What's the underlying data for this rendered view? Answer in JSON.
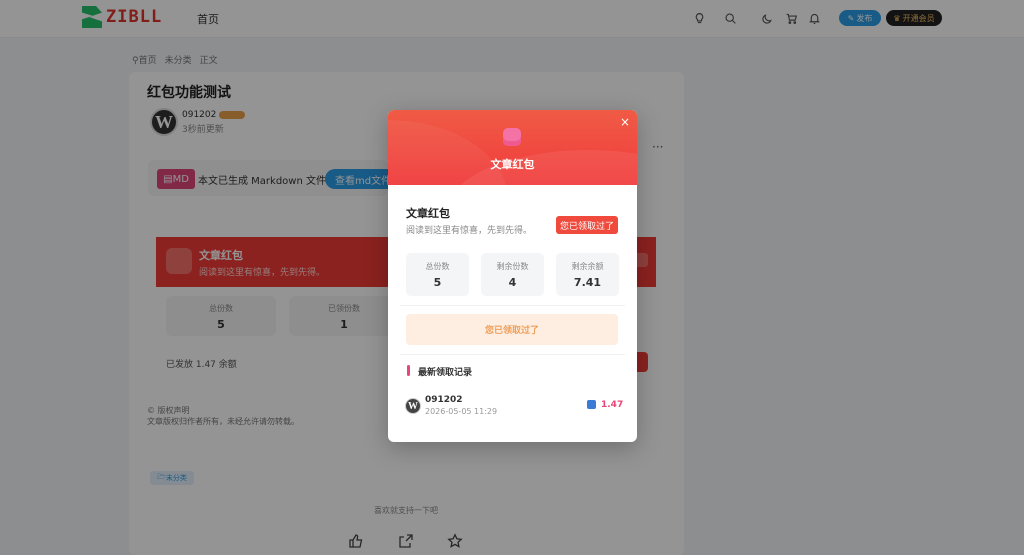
{
  "header": {
    "logo_text": "ZIBLL",
    "logo_subtitle": "",
    "nav_home": "首页",
    "publish_label": "发布",
    "vip_label": "开通会员",
    "icons": [
      "bulb-icon",
      "search-icon",
      "moon-icon",
      "cart-icon",
      "bell-icon"
    ]
  },
  "breadcrumb": {
    "items": [
      "首页",
      "未分类",
      "正文"
    ]
  },
  "post": {
    "title": "红包功能测试",
    "author": "091202",
    "updated": "3秒前更新",
    "avatar_letter": "W",
    "more": "···",
    "md_tag": "MD",
    "md_text": "本文已生成 Markdown 文件",
    "md_button": "查看md文件"
  },
  "redpack_banner": {
    "title": "文章红包",
    "subtitle": "阅读到这里有惊喜，先到先得。",
    "stats": [
      {
        "label": "总份数",
        "value": "5"
      },
      {
        "label": "已领份数",
        "value": "1"
      }
    ],
    "sent_text": "已发放 1.47 余额"
  },
  "copyright": {
    "title": "© 版权声明",
    "text": "文章版权归作者所有，未经允许请勿转载。"
  },
  "category_tag": "未分类",
  "support_text": "喜欢就支持一下吧",
  "modal": {
    "head_title": "文章红包",
    "close": "×",
    "title": "文章红包",
    "subtitle": "阅读到这里有惊喜，先到先得。",
    "claimed_button": "您已领取过了",
    "stats": [
      {
        "label": "总份数",
        "value": "5"
      },
      {
        "label": "剩余份数",
        "value": "4"
      },
      {
        "label": "剩余余额",
        "value": "7.41"
      }
    ],
    "claim_bar": "您已领取过了",
    "records_title": "最新领取记录",
    "records": [
      {
        "name": "091202",
        "time": "2026-05-05 11:29",
        "amount": "1.47",
        "avatar_letter": "W"
      }
    ]
  },
  "colors": {
    "accent_red": "#ef3b36",
    "accent_blue": "#2a9ee8",
    "accent_pink": "#e8457a",
    "claim_bar_text": "#f0a05a"
  }
}
